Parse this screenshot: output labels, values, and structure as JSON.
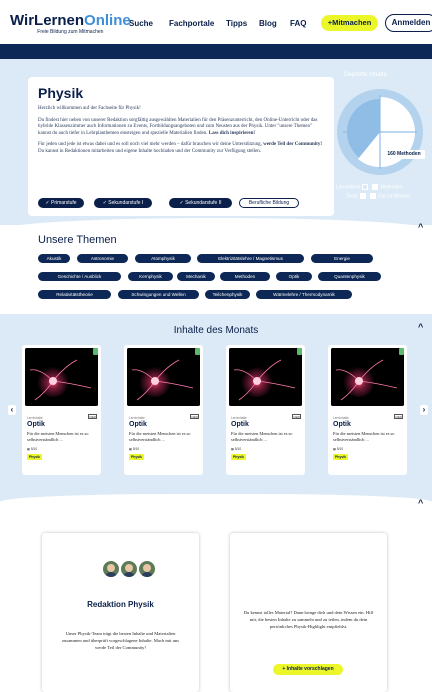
{
  "header": {
    "logo_main_a": "WirLernen",
    "logo_main_b": "Online",
    "logo_sub": "Freie Bildung zum Mitmachen",
    "nav": [
      "Suche",
      "Fachportale",
      "Tipps",
      "Blog",
      "FAQ"
    ],
    "mitmachen": "+Mitmachen",
    "anmelden": "Anmelden"
  },
  "hero": {
    "title": "Physik",
    "p1": "Herzlich willkommen auf der Fachseite für Physik!",
    "p2": "Du findest hier neben von unserer Redaktion sorgfältig ausgewählten Materialien für den Präsenzunterricht, den Online-Unterricht oder das hybride Klassenzimmer auch Informationen zu Events, Fortbildungsangeboten und zum Neusten aus der Physik. Unter \"unsere Themen\" kannst du auch tiefer in Lehrplanthemen einsteigen und spezielle Materialien finden.",
    "p2_bold": "Lass dich inspirieren!",
    "p3_a": "Für jeden und jede ist etwas dabei und es soll noch viel mehr werden – dafür brauchen wir deine Unterstützung,",
    "p3_bold": "werde Teil der Community!",
    "p3_b": "Du kannst in Redaktionen mitarbeiten und eigene Inhalte hochladen und der Community zur Verfügung stellen.",
    "chips": [
      "✓ Primarstufe",
      "✓ Sekundarstufe I",
      "✓ Sekundarstufe II",
      "Berufliche Bildung"
    ]
  },
  "stats": {
    "title": "Geprüfte Inhalte",
    "badge": "160 Methoden",
    "legend_a_left": "Lernvideos",
    "legend_a_right": "Methoden",
    "legend_b_left": "Tools",
    "legend_b_right": "Gut zu Wissen",
    "colors": {
      "ring": "#b3d2ee",
      "slice": "#ffffff",
      "bg": "#8fbde6"
    }
  },
  "themen": {
    "title": "Unsere Themen",
    "tags": [
      "Akustik",
      "Astronomie",
      "Atomphysik",
      "Elektrizitätslehre / Magnetismus",
      "Energie",
      "Geschichte / Ausblick",
      "Kernphysik",
      "Mechanik",
      "Methoden",
      "Optik",
      "Quantenphysik",
      "Relativitätstheorie",
      "Schwingungen und Wellen",
      "Teilchenphysik",
      "Wärmelehre / Thermodynamik"
    ]
  },
  "inhalte": {
    "title": "Inhalte des Monats",
    "cards": [
      {
        "cat": "Lerninhalte",
        "oer": "OER",
        "title": "Optik",
        "desc": "Für die meisten Menschen ist es so selbstverständlich ...",
        "meta": "▦ 5/10",
        "tag": "Physik"
      },
      {
        "cat": "Lerninhalte",
        "oer": "OER",
        "title": "Optik",
        "desc": "Für die meisten Menschen ist es so selbstverständlich ...",
        "meta": "▦ 5/10",
        "tag": "Physik"
      },
      {
        "cat": "Lerninhalte",
        "oer": "OER",
        "title": "Optik",
        "desc": "Für die meisten Menschen ist es so selbstverständlich ...",
        "meta": "▦ 5/10",
        "tag": "Physik"
      },
      {
        "cat": "Lerninhalte",
        "oer": "OER",
        "title": "Optik",
        "desc": "Für die meisten Menschen ist es so selbstverständlich ...",
        "meta": "▦ 5/10",
        "tag": "Physik"
      }
    ],
    "prev": "‹",
    "next": "›"
  },
  "redaktion": {
    "title": "Redaktion Physik",
    "text": "Unser Physik-Team trägt die besten Inhalte und Materialien zusammen und überprüft vorgeschlagene Inhalte. Mach mit uns werde Teil der Community!",
    "suggest_text": "Du kennst tolles Material? Dann bringe dich und dein Wissen ein. Hilf mit, die besten Inhalte zu sammeln und zu teilen, indem du dein persönliches Physik-Highlight empfiehlst.",
    "suggest_button": "+ Inhalte vorschlagen"
  },
  "chevron": "^"
}
